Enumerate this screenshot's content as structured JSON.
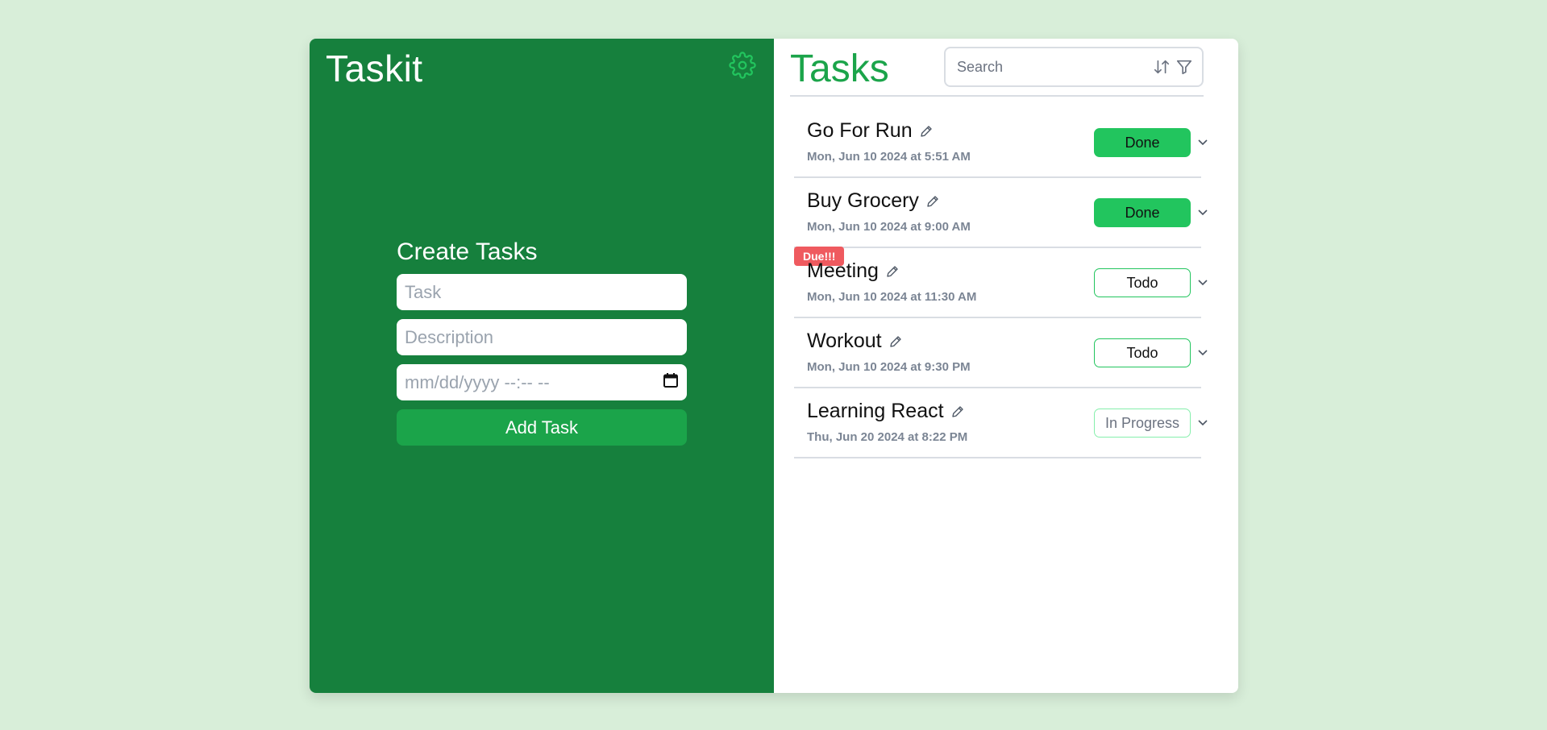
{
  "brand": "Taskit",
  "create": {
    "heading": "Create Tasks",
    "task_placeholder": "Task",
    "description_placeholder": "Description",
    "datetime_placeholder": "mm/dd/yyyy --:-- --",
    "add_label": "Add Task"
  },
  "tasks_panel": {
    "title": "Tasks",
    "search_placeholder": "Search"
  },
  "tasks": [
    {
      "name": "Go For Run",
      "date": "Mon, Jun 10 2024 at 5:51 AM",
      "status": "Done",
      "due": ""
    },
    {
      "name": "Buy Grocery",
      "date": "Mon, Jun 10 2024 at 9:00 AM",
      "status": "Done",
      "due": ""
    },
    {
      "name": "Meeting",
      "date": "Mon, Jun 10 2024 at 11:30 AM",
      "status": "Todo",
      "due": "Due!!!"
    },
    {
      "name": "Workout",
      "date": "Mon, Jun 10 2024 at 9:30 PM",
      "status": "Todo",
      "due": ""
    },
    {
      "name": "Learning React",
      "date": "Thu, Jun 20 2024 at 8:22 PM",
      "status": "In Progress",
      "due": ""
    }
  ],
  "colors": {
    "left_panel": "#16803d",
    "accent": "#1ba44a",
    "done": "#22c55e",
    "due_badge": "#ef5a5f",
    "page_bg": "#d8eed9"
  },
  "icons": {
    "settings": "gear-icon",
    "sort": "sort-arrows-icon",
    "filter": "filter-icon",
    "edit": "pencil-icon",
    "expand": "chevron-down-icon",
    "calendar": "calendar-icon"
  }
}
